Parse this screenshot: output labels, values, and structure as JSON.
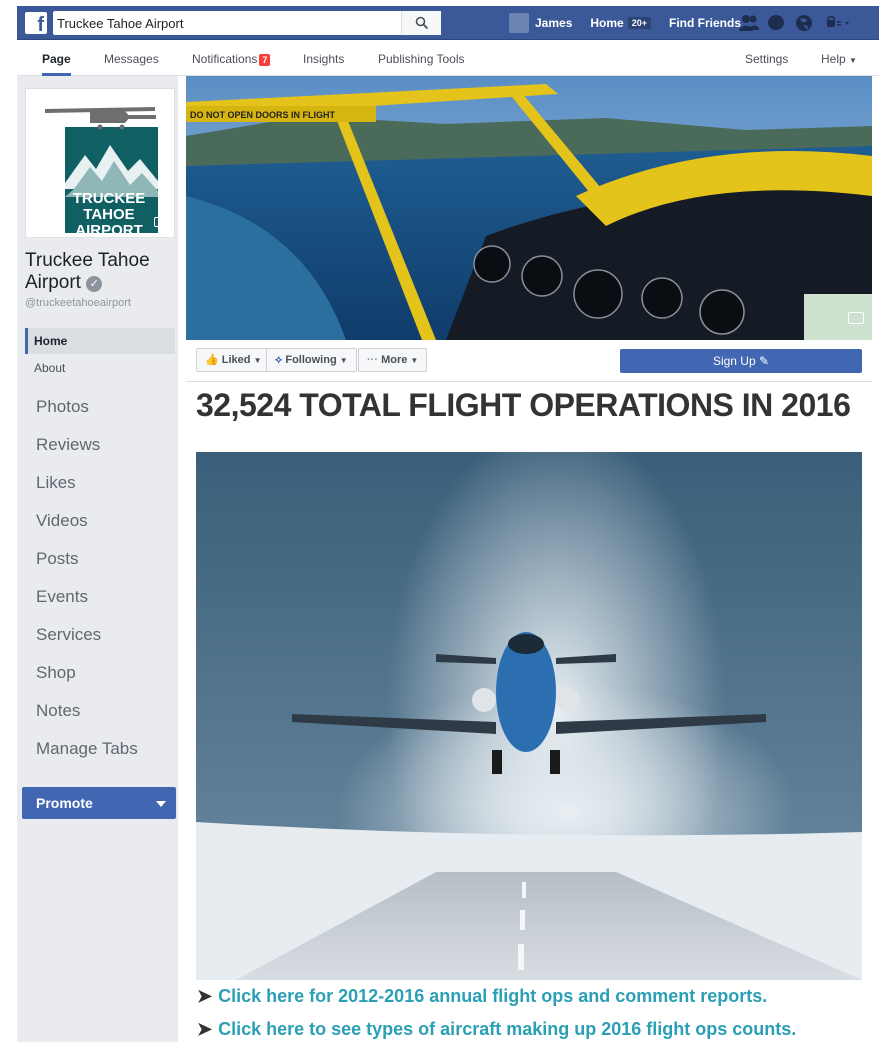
{
  "topbar": {
    "search_value": "Truckee Tahoe Airport",
    "user_name": "James",
    "home_label": "Home",
    "home_badge": "20+",
    "find_friends": "Find Friends"
  },
  "page_nav": {
    "tabs": [
      {
        "label": "Page"
      },
      {
        "label": "Messages"
      },
      {
        "label": "Notifications",
        "badge": "7"
      },
      {
        "label": "Insights"
      },
      {
        "label": "Publishing Tools"
      }
    ],
    "settings": "Settings",
    "help": "Help"
  },
  "profile": {
    "logo_lines": [
      "TRUCKEE",
      "TAHOE",
      "AIRPORT"
    ],
    "page_name": "Truckee Tahoe Airport",
    "handle": "@truckeetahoeairport"
  },
  "sidebar": {
    "home": "Home",
    "about": "About",
    "items": [
      "Photos",
      "Reviews",
      "Likes",
      "Videos",
      "Posts",
      "Events",
      "Services",
      "Shop",
      "Notes",
      "Manage Tabs"
    ],
    "promote": "Promote"
  },
  "cover": {
    "sign_text": "DO NOT OPEN DOORS IN FLIGHT"
  },
  "actions": {
    "liked": "Liked",
    "following": "Following",
    "more": "More",
    "signup": "Sign Up"
  },
  "content": {
    "headline": "32,524 TOTAL FLIGHT OPERATIONS IN 2016",
    "links": [
      "Click here for 2012-2016 annual flight ops and comment reports.",
      "Click here to see types of aircraft making up 2016 flight ops counts."
    ]
  },
  "colors": {
    "fb_blue": "#3b5998",
    "button_blue": "#4267b2",
    "link_teal": "#2a9fb5"
  }
}
